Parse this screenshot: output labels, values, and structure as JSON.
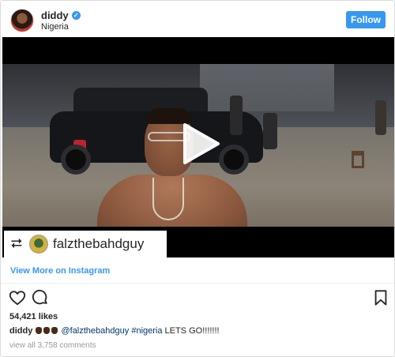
{
  "header": {
    "username": "diddy",
    "verified": true,
    "location": "Nigeria",
    "follow_label": "Follow"
  },
  "video": {
    "repost_user": "falzthebahdguy"
  },
  "view_more_label": "View More on Instagram",
  "actions": {
    "like_icon": "heart-icon",
    "comment_icon": "comment-icon",
    "save_icon": "bookmark-icon"
  },
  "likes": "54,421 likes",
  "caption": {
    "user": "diddy",
    "mention": "@falzthebahdguy",
    "hashtag": "#nigeria",
    "text": "LETS GO!!!!!!!"
  },
  "comments_label": "view all 3,758 comments",
  "colors": {
    "accent": "#3897f0",
    "link": "#003569",
    "muted": "#999999"
  }
}
